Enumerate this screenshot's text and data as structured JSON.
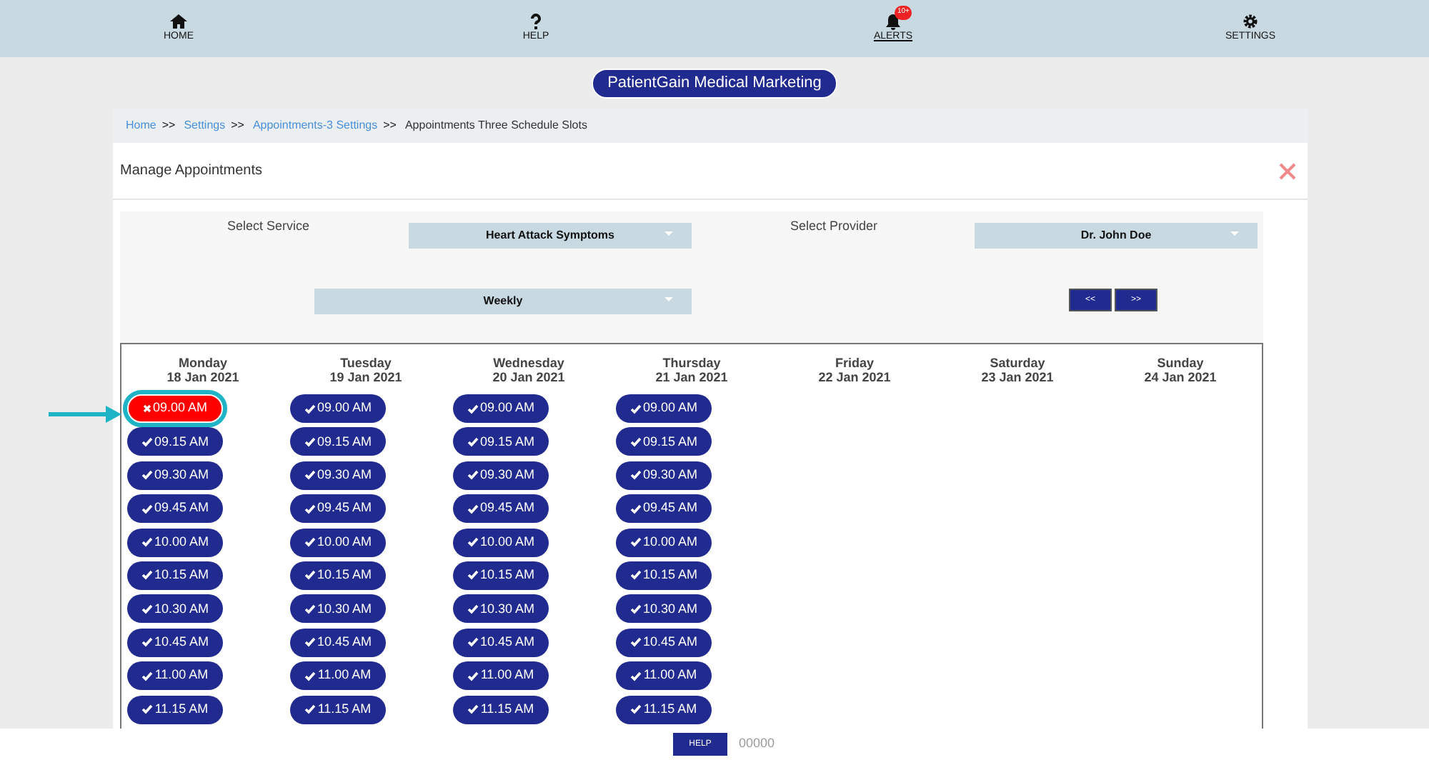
{
  "nav": [
    {
      "kind": "home",
      "label": "HOME",
      "selected": false
    },
    {
      "kind": "help",
      "label": "HELP",
      "selected": false
    },
    {
      "kind": "bell",
      "label": "ALERTS",
      "selected": true,
      "badge": "10+"
    },
    {
      "kind": "gear",
      "label": "SETTINGS",
      "selected": false
    }
  ],
  "brand": "PatientGain Medical Marketing",
  "breadcrumb": {
    "links": [
      "Home",
      "Settings",
      "Appointments-3 Settings"
    ],
    "separator": ">>",
    "current": "Appointments Three Schedule Slots"
  },
  "title": "Manage Appointments",
  "filters": {
    "service_label": "Select Service",
    "service": "Heart Attack Symptoms",
    "provider_label": "Select Provider",
    "provider": "Dr. John Doe",
    "period": "Weekly",
    "prev": "<<",
    "next": ">>"
  },
  "days": [
    {
      "day": "Monday",
      "date": "18 Jan 2021",
      "slots": [
        {
          "time": "09.00 AM",
          "blocked": true,
          "highlighted": true
        },
        {
          "time": "09.15 AM",
          "blocked": false,
          "highlighted": false
        },
        {
          "time": "09.30 AM",
          "blocked": false,
          "highlighted": false
        },
        {
          "time": "09.45 AM",
          "blocked": false,
          "highlighted": false
        },
        {
          "time": "10.00 AM",
          "blocked": false,
          "highlighted": false
        },
        {
          "time": "10.15 AM",
          "blocked": false,
          "highlighted": false
        },
        {
          "time": "10.30 AM",
          "blocked": false,
          "highlighted": false
        },
        {
          "time": "10.45 AM",
          "blocked": false,
          "highlighted": false
        },
        {
          "time": "11.00 AM",
          "blocked": false,
          "highlighted": false
        },
        {
          "time": "11.15 AM",
          "blocked": false,
          "highlighted": false
        }
      ]
    },
    {
      "day": "Tuesday",
      "date": "19 Jan 2021",
      "slots": [
        {
          "time": "09.00 AM",
          "blocked": false,
          "highlighted": false
        },
        {
          "time": "09.15 AM",
          "blocked": false,
          "highlighted": false
        },
        {
          "time": "09.30 AM",
          "blocked": false,
          "highlighted": false
        },
        {
          "time": "09.45 AM",
          "blocked": false,
          "highlighted": false
        },
        {
          "time": "10.00 AM",
          "blocked": false,
          "highlighted": false
        },
        {
          "time": "10.15 AM",
          "blocked": false,
          "highlighted": false
        },
        {
          "time": "10.30 AM",
          "blocked": false,
          "highlighted": false
        },
        {
          "time": "10.45 AM",
          "blocked": false,
          "highlighted": false
        },
        {
          "time": "11.00 AM",
          "blocked": false,
          "highlighted": false
        },
        {
          "time": "11.15 AM",
          "blocked": false,
          "highlighted": false
        }
      ]
    },
    {
      "day": "Wednesday",
      "date": "20 Jan 2021",
      "slots": [
        {
          "time": "09.00 AM",
          "blocked": false,
          "highlighted": false
        },
        {
          "time": "09.15 AM",
          "blocked": false,
          "highlighted": false
        },
        {
          "time": "09.30 AM",
          "blocked": false,
          "highlighted": false
        },
        {
          "time": "09.45 AM",
          "blocked": false,
          "highlighted": false
        },
        {
          "time": "10.00 AM",
          "blocked": false,
          "highlighted": false
        },
        {
          "time": "10.15 AM",
          "blocked": false,
          "highlighted": false
        },
        {
          "time": "10.30 AM",
          "blocked": false,
          "highlighted": false
        },
        {
          "time": "10.45 AM",
          "blocked": false,
          "highlighted": false
        },
        {
          "time": "11.00 AM",
          "blocked": false,
          "highlighted": false
        },
        {
          "time": "11.15 AM",
          "blocked": false,
          "highlighted": false
        }
      ]
    },
    {
      "day": "Thursday",
      "date": "21 Jan 2021",
      "slots": [
        {
          "time": "09.00 AM",
          "blocked": false,
          "highlighted": false
        },
        {
          "time": "09.15 AM",
          "blocked": false,
          "highlighted": false
        },
        {
          "time": "09.30 AM",
          "blocked": false,
          "highlighted": false
        },
        {
          "time": "09.45 AM",
          "blocked": false,
          "highlighted": false
        },
        {
          "time": "10.00 AM",
          "blocked": false,
          "highlighted": false
        },
        {
          "time": "10.15 AM",
          "blocked": false,
          "highlighted": false
        },
        {
          "time": "10.30 AM",
          "blocked": false,
          "highlighted": false
        },
        {
          "time": "10.45 AM",
          "blocked": false,
          "highlighted": false
        },
        {
          "time": "11.00 AM",
          "blocked": false,
          "highlighted": false
        },
        {
          "time": "11.15 AM",
          "blocked": false,
          "highlighted": false
        }
      ]
    },
    {
      "day": "Friday",
      "date": "22 Jan 2021"
    },
    {
      "day": "Saturday",
      "date": "23 Jan 2021"
    },
    {
      "day": "Sunday",
      "date": "24 Jan 2021"
    }
  ],
  "footer": {
    "button": "HELP",
    "code": "00000"
  }
}
